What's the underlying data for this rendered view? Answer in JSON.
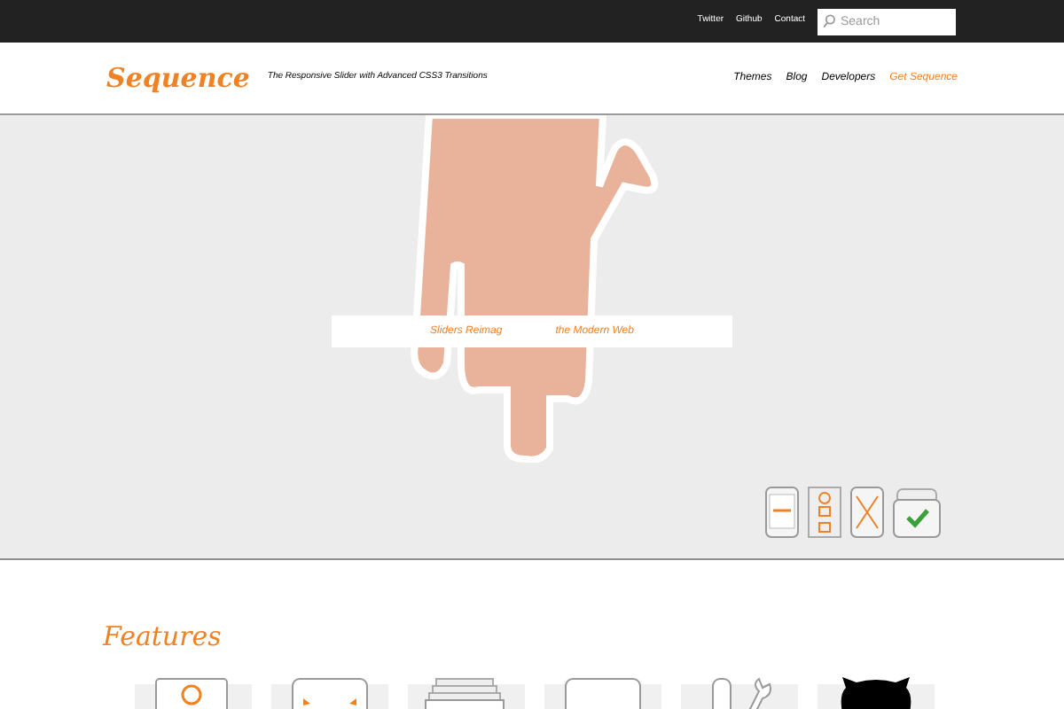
{
  "top_bar": {
    "links": [
      "Twitter",
      "Github",
      "Contact"
    ],
    "search": {
      "placeholder": "Search"
    }
  },
  "header": {
    "logo": "Sequence",
    "tagline": "The Responsive Slider with Advanced CSS3 Transitions",
    "nav": [
      {
        "label": "Themes",
        "selected": false
      },
      {
        "label": "Blog",
        "selected": false
      },
      {
        "label": "Developers",
        "selected": false
      },
      {
        "label": "Get Sequence",
        "selected": true
      }
    ]
  },
  "slider": {
    "caption_parts": [
      "Sliders Reimag",
      "the Modern Web"
    ]
  },
  "features": {
    "title": "Features"
  }
}
